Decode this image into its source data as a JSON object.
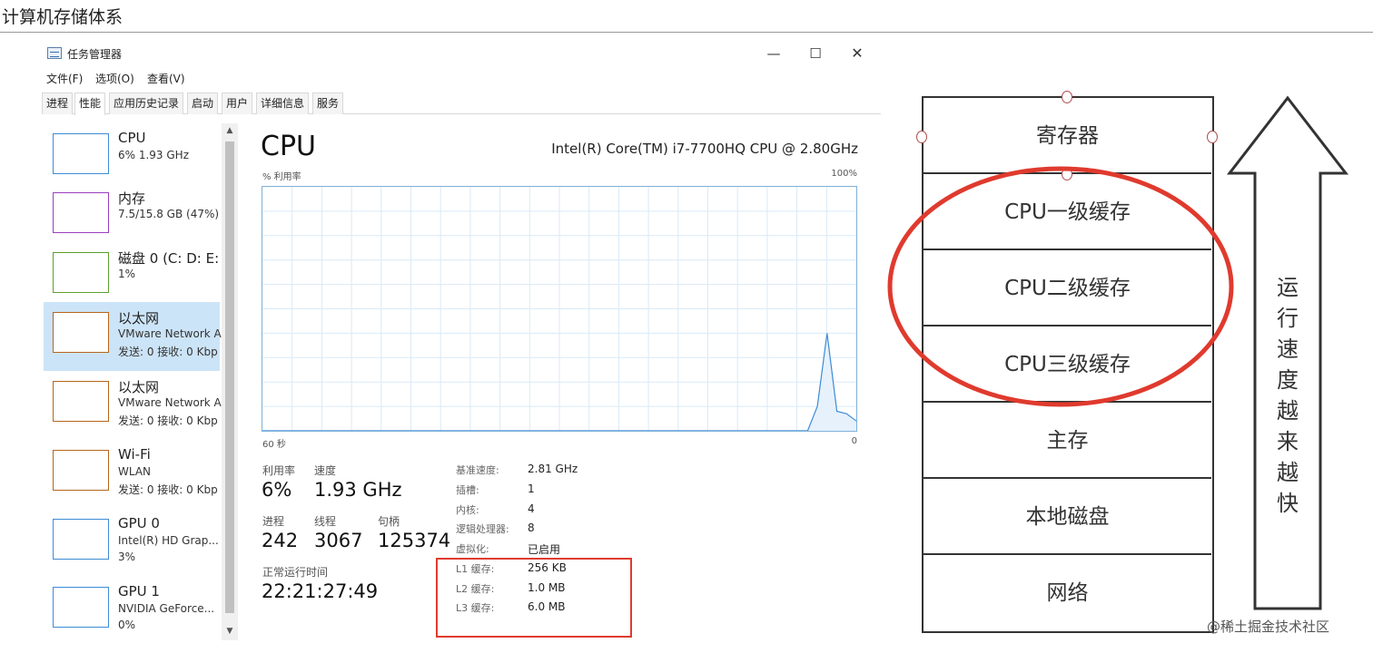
{
  "page": {
    "title": "计算机存储体系"
  },
  "window": {
    "title": "任务管理器",
    "controls": {
      "minimize": "—",
      "maximize": "☐",
      "close": "✕"
    }
  },
  "menu": [
    "文件(F)",
    "选项(O)",
    "查看(V)"
  ],
  "tabs": [
    {
      "label": "进程",
      "active": false
    },
    {
      "label": "性能",
      "active": true
    },
    {
      "label": "应用历史记录",
      "active": false
    },
    {
      "label": "启动",
      "active": false
    },
    {
      "label": "用户",
      "active": false
    },
    {
      "label": "详细信息",
      "active": false
    },
    {
      "label": "服务",
      "active": false
    }
  ],
  "sidebar": {
    "items": [
      {
        "name": "CPU",
        "line2": "6% 1.93 GHz",
        "line3": "",
        "color": "#3c8cd6",
        "selected": false
      },
      {
        "name": "内存",
        "line2": "7.5/15.8 GB (47%)",
        "line3": "",
        "color": "#9b3fbf",
        "selected": false
      },
      {
        "name": "磁盘 0 (C: D: E:",
        "line2": "1%",
        "line3": "",
        "color": "#5aa02c",
        "selected": false
      },
      {
        "name": "以太网",
        "line2": "VMware Network A",
        "line3": "发送: 0 接收: 0 Kbp",
        "color": "#b5661b",
        "selected": true
      },
      {
        "name": "以太网",
        "line2": "VMware Network A",
        "line3": "发送: 0 接收: 0 Kbp",
        "color": "#b5661b",
        "selected": false
      },
      {
        "name": "Wi-Fi",
        "line2": "WLAN",
        "line3": "发送: 0 接收: 0 Kbp",
        "color": "#b5661b",
        "selected": false
      },
      {
        "name": "GPU 0",
        "line2": "Intel(R) HD Grap...",
        "line3": "3%",
        "color": "#3c8cd6",
        "selected": false
      },
      {
        "name": "GPU 1",
        "line2": "NVIDIA GeForce...",
        "line3": "0%",
        "color": "#3c8cd6",
        "selected": false
      }
    ],
    "scroll_up": "▲",
    "scroll_down": "▼"
  },
  "cpu": {
    "heading": "CPU",
    "model": "Intel(R) Core(TM) i7-7700HQ CPU @ 2.80GHz",
    "util_label": "% 利用率",
    "util_max": "100%",
    "time_left": "60 秒",
    "time_right": "0",
    "stats": {
      "utilization": {
        "label": "利用率",
        "value": "6%"
      },
      "speed": {
        "label": "速度",
        "value": "1.93 GHz"
      },
      "processes": {
        "label": "进程",
        "value": "242"
      },
      "threads": {
        "label": "线程",
        "value": "3067"
      },
      "handles": {
        "label": "句柄",
        "value": "125374"
      },
      "uptime": {
        "label": "正常运行时间",
        "value": "22:21:27:49"
      }
    },
    "specs": [
      {
        "key": "基准速度:",
        "value": "2.81 GHz"
      },
      {
        "key": "插槽:",
        "value": "1"
      },
      {
        "key": "内核:",
        "value": "4"
      },
      {
        "key": "逻辑处理器:",
        "value": "8"
      },
      {
        "key": "虚拟化:",
        "value": "已启用"
      },
      {
        "key": "L1 缓存:",
        "value": "256 KB"
      },
      {
        "key": "L2 缓存:",
        "value": "1.0 MB"
      },
      {
        "key": "L3 缓存:",
        "value": "6.0 MB"
      }
    ],
    "graph_values": [
      0,
      0,
      0,
      0,
      0,
      0,
      0,
      0,
      0,
      0,
      0,
      0,
      0,
      0,
      0,
      0,
      0,
      0,
      0,
      0,
      0,
      0,
      0,
      0,
      0,
      0,
      0,
      0,
      0,
      0,
      0,
      0,
      0,
      0,
      0,
      0,
      0,
      0,
      0,
      0,
      0,
      0,
      0,
      0,
      0,
      0,
      0,
      0,
      0,
      0,
      0,
      0,
      0,
      0,
      0,
      0,
      0,
      10,
      40,
      8,
      7,
      4
    ],
    "colors": {
      "line": "#3c8cd6",
      "grid": "#d9eaf7"
    }
  },
  "hierarchy": {
    "layers": [
      "寄存器",
      "CPU一级缓存",
      "CPU二级缓存",
      "CPU三级缓存",
      "主存",
      "本地磁盘",
      "网络"
    ],
    "speed_label": [
      "运",
      "行",
      "速",
      "度",
      "越",
      "来",
      "越",
      "快"
    ],
    "highlight_color": "#e03a2e"
  },
  "watermark": "@稀土掘金技术社区"
}
